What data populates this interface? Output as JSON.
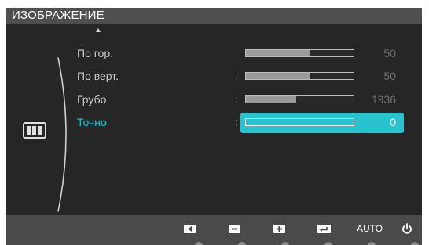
{
  "osd": {
    "title": "ИЗОБРАЖЕНИЕ",
    "menu_icon": "picture-menu-icon",
    "scroll_indicator": "up-arrow-icon",
    "items": [
      {
        "label": "По гор.",
        "value": "50",
        "level_percent": 59,
        "selected": false
      },
      {
        "label": "По верт.",
        "value": "50",
        "level_percent": 59,
        "selected": false
      },
      {
        "label": "Грубо",
        "value": "1936",
        "level_percent": 47,
        "selected": false
      },
      {
        "label": "Точно",
        "value": "0",
        "level_percent": 0,
        "selected": true
      }
    ],
    "separator": ":",
    "bottom_buttons": [
      {
        "name": "left-arrow-icon",
        "label": ""
      },
      {
        "name": "minus-icon",
        "label": ""
      },
      {
        "name": "plus-icon",
        "label": ""
      },
      {
        "name": "enter-icon",
        "label": ""
      },
      {
        "name": "auto-button",
        "label": "AUTO"
      },
      {
        "name": "power-icon",
        "label": ""
      }
    ],
    "colors": {
      "accent": "#27c3cf",
      "background": "#262626",
      "title_bar": "#4f4f4f",
      "bottom_bar": "#4a4a4a"
    }
  }
}
